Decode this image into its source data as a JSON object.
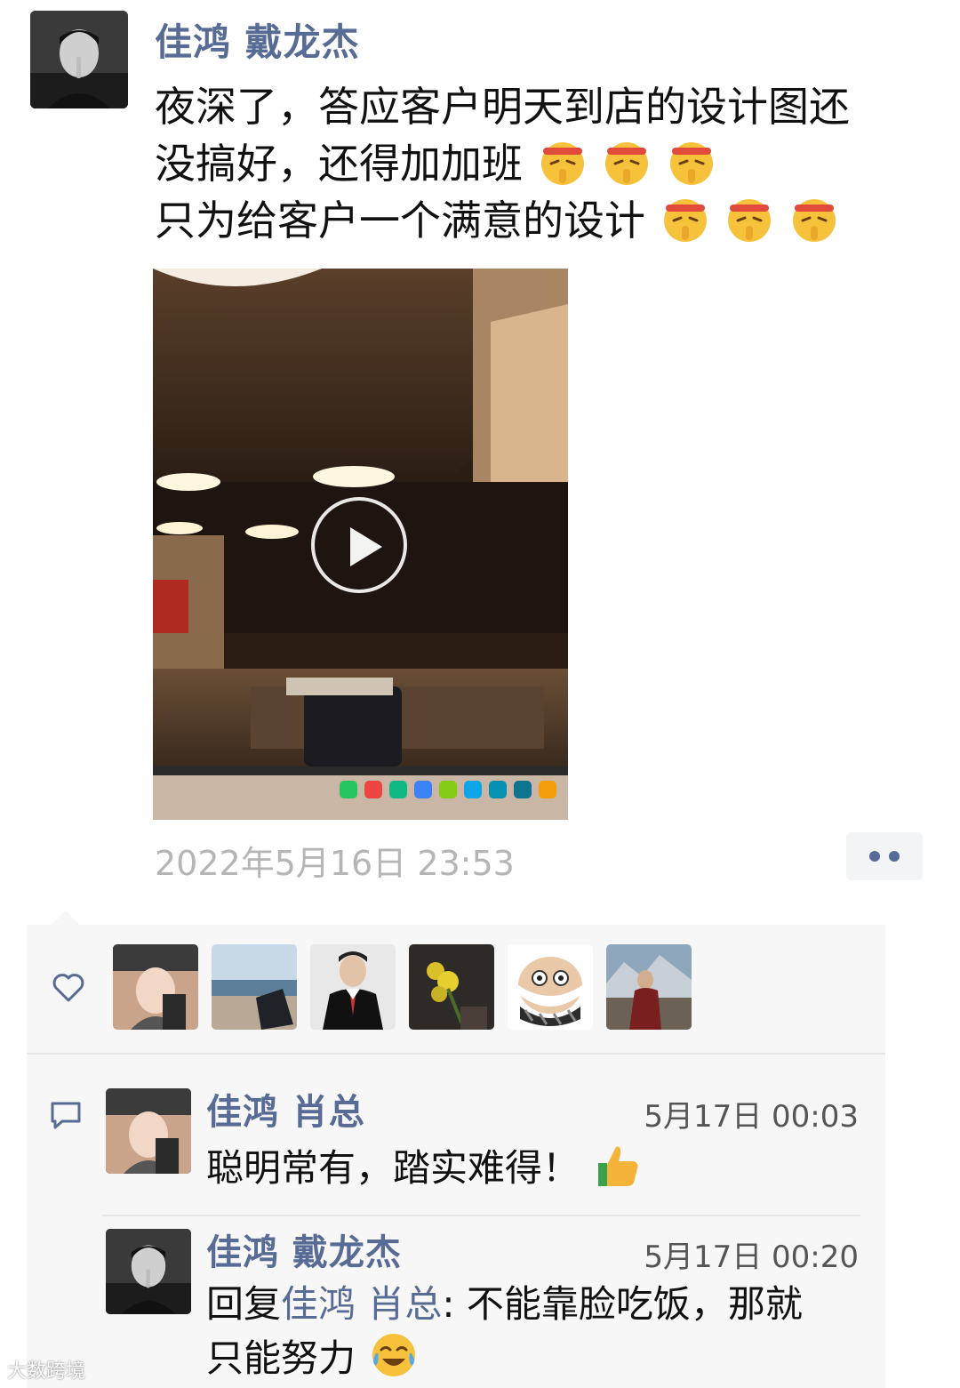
{
  "post": {
    "author": "佳鸿 戴龙杰",
    "text_lines": [
      "夜深了，答应客户明天到店的设计图还",
      "没搞好，还得加加班",
      "只为给客户一个满意的设计"
    ],
    "line2_emoji": [
      "shushing-face-emoji",
      "shushing-face-emoji",
      "shushing-face-emoji"
    ],
    "line3_emoji": [
      "shushing-face-emoji",
      "shushing-face-emoji",
      "shushing-face-emoji"
    ],
    "video": {
      "icon": "play-icon"
    },
    "timestamp": "2022年5月16日 23:53",
    "more_icon": "more-dots-icon"
  },
  "likes": {
    "icon": "heart-outline-icon",
    "count_shown": 6
  },
  "comments": {
    "icon": "comment-bubble-icon",
    "items": [
      {
        "author": "佳鸿 肖总",
        "time": "5月17日 00:03",
        "text": "聪明常有，踏实难得！",
        "emoji": "thumbs-up-emoji"
      },
      {
        "author": "佳鸿 戴龙杰",
        "time": "5月17日 00:20",
        "reply_prefix": "回复",
        "reply_to": "佳鸿 肖总",
        "reply_sep": ":",
        "text_line1": " 不能靠脸吃饭，那就",
        "text_line2": "只能努力",
        "emoji": "crying-laughing-emoji"
      }
    ]
  },
  "watermark": "大数跨境",
  "colors": {
    "link": "#576b95",
    "panel_bg": "#f7f7f7",
    "timestamp": "#b5b5b5",
    "text": "#111111"
  }
}
